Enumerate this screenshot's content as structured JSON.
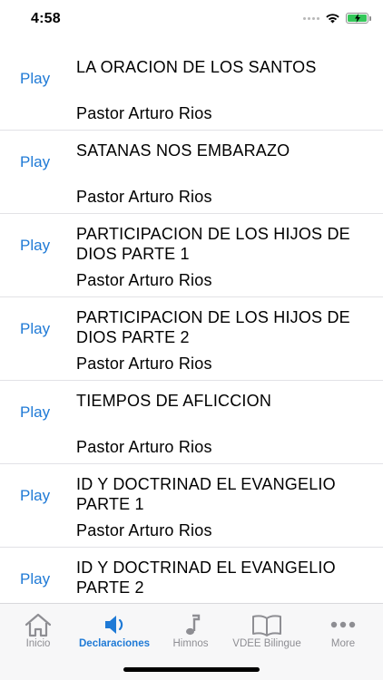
{
  "status_bar": {
    "time": "4:58"
  },
  "colors": {
    "accent": "#1f7ad6",
    "inactive": "#8e8e93",
    "battery": "#34c759"
  },
  "rows": [
    {
      "play": "Play",
      "title": "LA ORACION DE LOS SANTOS",
      "author": "Pastor Arturo Rios"
    },
    {
      "play": "Play",
      "title": "SATANAS NOS EMBARAZO",
      "author": "Pastor Arturo Rios"
    },
    {
      "play": "Play",
      "title": "PARTICIPACION DE LOS HIJOS DE DIOS PARTE 1",
      "author": "Pastor Arturo Rios"
    },
    {
      "play": "Play",
      "title": "PARTICIPACION DE LOS HIJOS DE DIOS PARTE 2",
      "author": "Pastor Arturo Rios"
    },
    {
      "play": "Play",
      "title": "TIEMPOS DE AFLICCION",
      "author": "Pastor Arturo Rios"
    },
    {
      "play": "Play",
      "title": "ID Y DOCTRINAD EL EVANGELIO PARTE 1",
      "author": "Pastor Arturo Rios"
    },
    {
      "play": "Play",
      "title": "ID Y DOCTRINAD EL EVANGELIO PARTE 2",
      "author": ""
    }
  ],
  "tabs": [
    {
      "label": "Inicio",
      "icon": "home-icon",
      "active": false
    },
    {
      "label": "Declaraciones",
      "icon": "speaker-icon",
      "active": true
    },
    {
      "label": "Himnos",
      "icon": "music-note-icon",
      "active": false
    },
    {
      "label": "VDEE Bilingue",
      "icon": "book-icon",
      "active": false
    },
    {
      "label": "More",
      "icon": "more-icon",
      "active": false
    }
  ]
}
